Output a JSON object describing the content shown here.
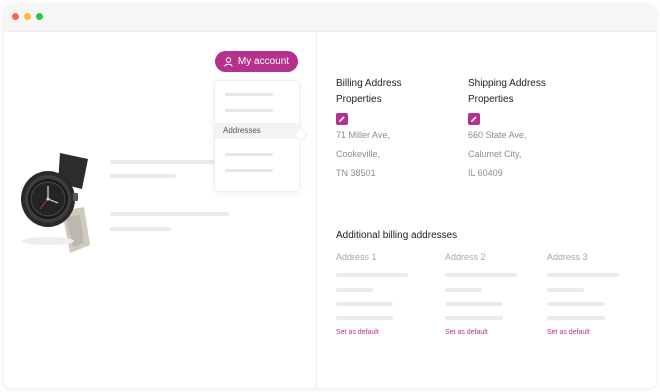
{
  "account": {
    "button_label": "My account",
    "icon": "user-icon"
  },
  "dropdown": {
    "selected_label": "Addresses"
  },
  "billing": {
    "title_line1": "Billing Address",
    "title_line2": "Properties",
    "edit_icon": "pencil-icon",
    "lines": [
      "71 Miller Ave,",
      "Cookeville,",
      "TN 38501"
    ]
  },
  "shipping": {
    "title_line1": "Shipping Address",
    "title_line2": "Properties",
    "edit_icon": "pencil-icon",
    "lines": [
      "660 State Ave,",
      "Calumet City,",
      "IL 60409"
    ]
  },
  "additional": {
    "title": "Additional billing addresses",
    "columns": [
      {
        "title": "Address 1",
        "action": "Set as default"
      },
      {
        "title": "Address 2",
        "action": "Set as default"
      },
      {
        "title": "Address 3",
        "action": "Set as default"
      }
    ]
  },
  "colors": {
    "accent": "#b6318b",
    "placeholder": "#ebebeb"
  }
}
